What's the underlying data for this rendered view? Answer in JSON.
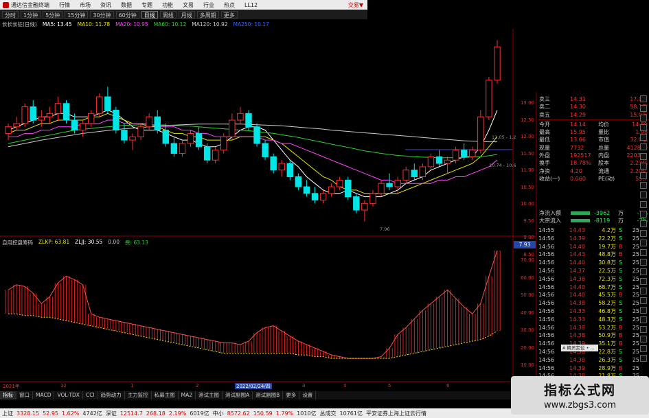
{
  "app": {
    "brand": "通达信金融终端",
    "menu": [
      "行情",
      "市场",
      "资讯",
      "数据",
      "专题",
      "功能",
      "文易",
      "行业",
      "热点",
      "LL12"
    ],
    "trade_label": "交易▼"
  },
  "periods": {
    "items": [
      "分时",
      "1分钟",
      "5分钟",
      "15分钟",
      "30分钟",
      "60分钟",
      "日线",
      "周线",
      "月线",
      "多周期",
      "更多"
    ],
    "active": "日线"
  },
  "indicators": {
    "title": "长长长征(日线)",
    "ma": [
      {
        "label": "MA5: 13.45",
        "color": "#ffffff"
      },
      {
        "label": "MA10: 11.78",
        "color": "#e6e600"
      },
      {
        "label": "MA20: 10.95",
        "color": "#ff44ff"
      },
      {
        "label": "MA60: 10.12",
        "color": "#2fd02f"
      },
      {
        "label": "MA120: 10.92",
        "color": "#cccccc"
      },
      {
        "label": "MA250: 10.17",
        "color": "#4060ff"
      }
    ]
  },
  "sub_indicator": {
    "name": "自用控盘筹码",
    "items": [
      {
        "label": "ZLKP: 63.81",
        "color": "#e6e600"
      },
      {
        "label": "ZLJJ: 30.55",
        "color": "#ffffff"
      },
      {
        "label": "0.00",
        "color": "#cccccc"
      },
      {
        "label": "费: 63.13",
        "color": "#2fd02f"
      }
    ]
  },
  "price_axis": [
    "13.00",
    "12.50",
    "12.00",
    "11.50",
    "11.00",
    "10.50",
    "10.00",
    "9.50",
    "9.00",
    "8.50"
  ],
  "sub_axis": [
    "70.00",
    "60.00",
    "50.00",
    "40.00",
    "30.00",
    "20.00",
    "10.00"
  ],
  "current_price_tag": "7.93",
  "chart_annotations": [
    "12.05 - 1.2",
    "10.74 - 10.6",
    "7.96"
  ],
  "chart_data": {
    "type": "candlestick",
    "ylim": [
      7.6,
      13.7
    ],
    "candles": [
      [
        10.6,
        10.9,
        10.4,
        10.8
      ],
      [
        10.8,
        11.1,
        10.7,
        10.9
      ],
      [
        10.9,
        11.5,
        10.8,
        11.4
      ],
      [
        11.4,
        11.6,
        10.9,
        11.0
      ],
      [
        11.0,
        11.3,
        10.8,
        11.1
      ],
      [
        11.1,
        11.4,
        10.9,
        11.2
      ],
      [
        11.2,
        11.7,
        11.0,
        11.5
      ],
      [
        11.5,
        11.6,
        10.9,
        11.0
      ],
      [
        11.0,
        11.2,
        10.6,
        10.7
      ],
      [
        10.7,
        11.0,
        10.5,
        10.9
      ],
      [
        10.9,
        11.3,
        10.8,
        11.2
      ],
      [
        11.2,
        11.8,
        11.1,
        11.7
      ],
      [
        11.7,
        12.0,
        11.2,
        11.3
      ],
      [
        11.3,
        11.4,
        10.6,
        10.7
      ],
      [
        10.7,
        10.9,
        10.3,
        10.4
      ],
      [
        10.4,
        10.6,
        10.1,
        10.5
      ],
      [
        10.5,
        10.9,
        10.4,
        10.8
      ],
      [
        10.8,
        11.2,
        10.7,
        11.1
      ],
      [
        11.1,
        11.3,
        10.6,
        10.7
      ],
      [
        10.7,
        10.9,
        10.2,
        10.3
      ],
      [
        10.3,
        10.5,
        9.9,
        10.0
      ],
      [
        10.0,
        10.4,
        9.9,
        10.3
      ],
      [
        10.3,
        10.7,
        10.2,
        10.6
      ],
      [
        10.6,
        10.8,
        10.1,
        10.2
      ],
      [
        10.2,
        10.3,
        9.7,
        9.8
      ],
      [
        9.8,
        10.2,
        9.7,
        10.1
      ],
      [
        10.1,
        10.6,
        10.0,
        10.5
      ],
      [
        10.5,
        11.2,
        10.4,
        11.0
      ],
      [
        11.0,
        11.4,
        10.9,
        11.2
      ],
      [
        11.2,
        11.3,
        10.7,
        10.8
      ],
      [
        10.8,
        10.9,
        10.2,
        10.3
      ],
      [
        10.3,
        10.4,
        9.8,
        9.9
      ],
      [
        9.9,
        10.0,
        9.4,
        9.5
      ],
      [
        9.5,
        9.8,
        9.3,
        9.7
      ],
      [
        9.7,
        9.8,
        9.2,
        9.3
      ],
      [
        9.3,
        9.4,
        8.9,
        9.0
      ],
      [
        9.0,
        9.2,
        8.7,
        8.8
      ],
      [
        8.8,
        9.0,
        8.5,
        8.6
      ],
      [
        8.6,
        8.9,
        8.5,
        8.8
      ],
      [
        8.8,
        9.1,
        8.7,
        9.0
      ],
      [
        9.0,
        9.3,
        8.9,
        9.2
      ],
      [
        9.2,
        9.3,
        8.6,
        8.7
      ],
      [
        8.7,
        8.8,
        8.2,
        8.3
      ],
      [
        8.3,
        8.6,
        7.96,
        8.5
      ],
      [
        8.5,
        8.9,
        8.4,
        8.8
      ],
      [
        8.8,
        9.2,
        8.7,
        9.1
      ],
      [
        9.1,
        9.4,
        8.9,
        9.0
      ],
      [
        9.0,
        9.3,
        8.8,
        9.2
      ],
      [
        9.2,
        9.6,
        9.1,
        9.5
      ],
      [
        9.5,
        9.7,
        9.2,
        9.3
      ],
      [
        9.3,
        9.7,
        9.2,
        9.6
      ],
      [
        9.6,
        10.0,
        9.5,
        9.9
      ],
      [
        9.9,
        10.1,
        9.6,
        9.7
      ],
      [
        9.7,
        9.9,
        9.4,
        9.8
      ],
      [
        9.8,
        10.2,
        9.7,
        10.1
      ],
      [
        10.1,
        10.3,
        9.8,
        9.9
      ],
      [
        9.9,
        10.2,
        9.8,
        10.1
      ],
      [
        10.1,
        11.3,
        10.0,
        11.1
      ],
      [
        11.1,
        12.3,
        11.0,
        12.2
      ],
      [
        12.2,
        13.4,
        12.1,
        13.2
      ]
    ],
    "ma": [
      {
        "name": "MA5",
        "color": "#ffffff",
        "values": [
          10.7,
          10.8,
          10.9,
          11.0,
          11.1,
          11.1,
          11.2,
          11.2,
          11.1,
          11.1,
          11.1,
          11.2,
          11.3,
          11.2,
          11.0,
          10.8,
          10.7,
          10.7,
          10.7,
          10.6,
          10.5,
          10.4,
          10.4,
          10.3,
          10.2,
          10.2,
          10.3,
          10.5,
          10.7,
          10.8,
          10.8,
          10.7,
          10.4,
          10.1,
          9.8,
          9.6,
          9.3,
          9.1,
          8.9,
          8.8,
          8.8,
          8.9,
          8.8,
          8.7,
          8.7,
          8.7,
          8.8,
          8.9,
          9.1,
          9.2,
          9.3,
          9.5,
          9.6,
          9.7,
          9.8,
          9.9,
          9.9,
          10.2,
          10.7,
          11.3
        ]
      },
      {
        "name": "MA10",
        "color": "#e6e600",
        "values": [
          10.6,
          10.7,
          10.7,
          10.8,
          10.9,
          10.9,
          11.0,
          11.0,
          11.0,
          11.0,
          11.1,
          11.1,
          11.2,
          11.1,
          11.0,
          10.9,
          10.9,
          10.8,
          10.8,
          10.7,
          10.6,
          10.6,
          10.5,
          10.5,
          10.4,
          10.4,
          10.4,
          10.4,
          10.5,
          10.5,
          10.5,
          10.5,
          10.4,
          10.3,
          10.1,
          9.9,
          9.7,
          9.5,
          9.3,
          9.2,
          9.0,
          8.9,
          8.9,
          8.8,
          8.8,
          8.8,
          8.8,
          8.8,
          8.9,
          9.0,
          9.1,
          9.2,
          9.3,
          9.4,
          9.5,
          9.6,
          9.7,
          9.9,
          10.2,
          10.5
        ]
      },
      {
        "name": "MA20",
        "color": "#ff44ff",
        "values": [
          10.5,
          10.5,
          10.6,
          10.6,
          10.7,
          10.7,
          10.8,
          10.8,
          10.8,
          10.9,
          10.9,
          10.9,
          11.0,
          11.0,
          10.9,
          10.9,
          10.9,
          10.9,
          10.8,
          10.8,
          10.8,
          10.7,
          10.7,
          10.6,
          10.6,
          10.5,
          10.5,
          10.5,
          10.5,
          10.5,
          10.5,
          10.4,
          10.4,
          10.3,
          10.3,
          10.2,
          10.1,
          10.0,
          9.9,
          9.8,
          9.7,
          9.6,
          9.5,
          9.4,
          9.3,
          9.2,
          9.2,
          9.1,
          9.1,
          9.1,
          9.1,
          9.1,
          9.2,
          9.2,
          9.3,
          9.3,
          9.4,
          9.5,
          9.6,
          9.8
        ]
      },
      {
        "name": "MA60",
        "color": "#2fd02f",
        "values": [
          10.3,
          10.35,
          10.4,
          10.45,
          10.5,
          10.55,
          10.6,
          10.65,
          10.7,
          10.72,
          10.75,
          10.78,
          10.8,
          10.82,
          10.84,
          10.85,
          10.86,
          10.86,
          10.86,
          10.85,
          10.84,
          10.83,
          10.82,
          10.8,
          10.78,
          10.76,
          10.74,
          10.72,
          10.7,
          10.68,
          10.66,
          10.63,
          10.6,
          10.56,
          10.52,
          10.48,
          10.43,
          10.38,
          10.33,
          10.28,
          10.23,
          10.18,
          10.13,
          10.08,
          10.04,
          10.0,
          9.97,
          9.94,
          9.92,
          9.9,
          9.89,
          9.88,
          9.87,
          9.87,
          9.87,
          9.88,
          9.89,
          9.9,
          9.93,
          9.97
        ]
      },
      {
        "name": "MA120",
        "color": "#cccccc",
        "values": [
          10.2,
          10.25,
          10.3,
          10.35,
          10.4,
          10.44,
          10.48,
          10.52,
          10.56,
          10.6,
          10.63,
          10.66,
          10.69,
          10.72,
          10.74,
          10.76,
          10.78,
          10.8,
          10.82,
          10.84,
          10.85,
          10.86,
          10.87,
          10.88,
          10.88,
          10.88,
          10.88,
          10.88,
          10.88,
          10.87,
          10.86,
          10.85,
          10.84,
          10.83,
          10.81,
          10.79,
          10.77,
          10.75,
          10.73,
          10.7,
          10.68,
          10.66,
          10.64,
          10.62,
          10.6,
          10.58,
          10.56,
          10.54,
          10.52,
          10.5,
          10.48,
          10.46,
          10.44,
          10.42,
          10.4,
          10.38,
          10.37,
          10.36,
          10.35,
          10.35
        ]
      }
    ],
    "sub_series": {
      "name": "ZLKP",
      "ylim": [
        0,
        75
      ],
      "values": [
        52,
        55,
        54,
        50,
        44,
        48,
        56,
        60,
        58,
        55,
        38,
        36,
        35,
        34,
        33,
        32,
        31,
        30,
        29,
        28,
        27,
        26,
        25,
        24,
        23,
        22,
        21,
        21,
        20,
        22,
        27,
        30,
        31,
        28,
        25,
        22,
        20,
        18,
        16,
        14,
        13,
        12,
        12,
        12,
        12,
        13,
        18,
        26,
        30,
        35,
        40,
        44,
        48,
        52,
        47,
        42,
        38,
        44,
        60,
        75
      ],
      "signal": [
        38,
        38,
        37,
        37,
        36,
        36,
        35,
        34,
        33,
        32,
        31,
        30,
        29,
        28,
        27,
        26,
        25,
        24,
        23,
        22,
        21,
        20,
        19,
        18,
        17,
        16,
        15,
        15,
        15,
        15,
        15,
        15,
        15,
        15,
        15,
        14,
        14,
        13,
        13,
        12,
        12,
        12,
        12,
        12,
        12,
        12,
        12,
        13,
        14,
        15,
        16,
        17,
        18,
        19,
        20,
        21,
        22,
        23,
        25,
        28
      ]
    }
  },
  "date_axis": [
    "2021年",
    "12",
    "1",
    "2",
    "2022/02/24/四",
    "3",
    "4",
    "5",
    "6"
  ],
  "quote": {
    "rows": [
      {
        "l": "卖三",
        "v": "14.31",
        "l2": "",
        "v2": "17.0万"
      },
      {
        "l": "卖二",
        "v": "14.30",
        "l2": "",
        "v2": "58.1万"
      },
      {
        "l": "卖五",
        "v": "14.29",
        "l2": "",
        "v2": "15.0万"
      },
      {
        "l": "今开",
        "v": "14.14",
        "l2": "均价",
        "v2": "14.69"
      },
      {
        "l": "最高",
        "v": "15.95",
        "l2": "量比",
        "v2": "1.98"
      },
      {
        "l": "最低",
        "v": "13.66",
        "l2": "市值",
        "v2": "32.0亿"
      },
      {
        "l": "现量",
        "v": "7732",
        "l2": "总量",
        "v2": "412879"
      },
      {
        "l": "外盘",
        "v": "192517",
        "l2": "内盘",
        "v2": "220362"
      },
      {
        "l": "换手",
        "v": "18.78%",
        "l2": "股本",
        "v2": "2.23亿"
      },
      {
        "l": "净资",
        "v": "4.20",
        "l2": "流通",
        "v2": "2.20亿"
      },
      {
        "l": "收益(一)",
        "v": "0.060",
        "l2": "PE(动)",
        "v2": "59.7"
      }
    ]
  },
  "flow": [
    {
      "label": "净流入额",
      "value": "-3962",
      "unit": "万",
      "pct": "-7%"
    },
    {
      "label": "大宗流入",
      "value": "-8119",
      "unit": "万",
      "pct": "-7%"
    }
  ],
  "ticks": [
    {
      "t": "14:55",
      "p": "14.43",
      "v": "4.2万",
      "bs": "S",
      "n": "25"
    },
    {
      "t": "14:56",
      "p": "14.39",
      "v": "22.2万",
      "bs": "S",
      "n": "25"
    },
    {
      "t": "14:56",
      "p": "14.40",
      "v": "19.7万",
      "bs": "B",
      "n": "25"
    },
    {
      "t": "14:56",
      "p": "14.43",
      "v": "48.8万",
      "bs": "B",
      "n": "25"
    },
    {
      "t": "14:56",
      "p": "14.40",
      "v": "30.8万",
      "bs": "S",
      "n": "25"
    },
    {
      "t": "14:56",
      "p": "14.37",
      "v": "22.5万",
      "bs": "S",
      "n": "25"
    },
    {
      "t": "14:56",
      "p": "14.38",
      "v": "72.3万",
      "bs": "S",
      "n": "25"
    },
    {
      "t": "14:56",
      "p": "14.40",
      "v": "68.7万",
      "bs": "S",
      "n": "25"
    },
    {
      "t": "14:56",
      "p": "14.40",
      "v": "45.5万",
      "bs": "B",
      "n": "25"
    },
    {
      "t": "14:56",
      "p": "14.38",
      "v": "58.2万",
      "bs": "S",
      "n": "25"
    },
    {
      "t": "14:56",
      "p": "14.33",
      "v": "46.8万",
      "bs": "S",
      "n": "25"
    },
    {
      "t": "14:56",
      "p": "14.33",
      "v": "48.3万",
      "bs": "S",
      "n": "25"
    },
    {
      "t": "14:56",
      "p": "14.38",
      "v": "53.2万",
      "bs": "B",
      "n": "25"
    },
    {
      "t": "14:56",
      "p": "14.38",
      "v": "50.9万",
      "bs": "B",
      "n": "25"
    },
    {
      "t": "14:56",
      "p": "14.39",
      "v": "35.1万",
      "bs": "B",
      "n": "25"
    },
    {
      "t": "14:56",
      "p": "14.38",
      "v": "22.8万",
      "bs": "S",
      "n": "25"
    },
    {
      "t": "14:56",
      "p": "14.38",
      "v": "26.3万",
      "bs": "S",
      "n": "25"
    },
    {
      "t": "14:56",
      "p": "14.39",
      "v": "28.9万",
      "bs": "B",
      "n": "25"
    },
    {
      "t": "14:56",
      "p": "14.38",
      "v": "21.8万",
      "bs": "S",
      "n": "25"
    }
  ],
  "jump_box": "A 精灵定位 • ...",
  "tabs": [
    "指标",
    "窗口",
    "MACD",
    "VOL-TDX",
    "CCI",
    "趋势动力",
    "主力监控",
    "私募主图",
    "MA2",
    "测试主图",
    "测试副图A",
    "测试副图B",
    "更多",
    "设置"
  ],
  "status": {
    "items": [
      {
        "text": "上证",
        "c": "b"
      },
      {
        "text": "3328.15",
        "c": "r"
      },
      {
        "text": "52.95",
        "c": "r"
      },
      {
        "text": "1.62%",
        "c": "r"
      },
      {
        "text": "4742亿",
        "c": "b"
      },
      {
        "text": "深证",
        "c": "b"
      },
      {
        "text": "12514.7",
        "c": "r"
      },
      {
        "text": "268.18",
        "c": "r"
      },
      {
        "text": "2.19%",
        "c": "r"
      },
      {
        "text": "6019亿",
        "c": "b"
      },
      {
        "text": "中小",
        "c": "b"
      },
      {
        "text": "8572.62",
        "c": "r"
      },
      {
        "text": "150.59",
        "c": "r"
      },
      {
        "text": "1.79%",
        "c": "r"
      },
      {
        "text": "1010亿",
        "c": "b"
      },
      {
        "text": "总成交",
        "c": "b"
      },
      {
        "text": "10761亿",
        "c": "b"
      },
      {
        "text": "平安证券上海上证云行情",
        "c": "b"
      }
    ]
  },
  "watermark": {
    "line1": "指标公式网",
    "line2": "www.zbgs3.com"
  }
}
